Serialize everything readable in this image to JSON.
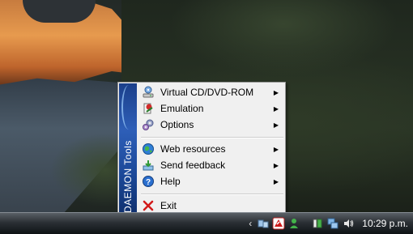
{
  "menu": {
    "banner_text": "DAEMON Tools",
    "items": [
      {
        "label": "Virtual CD/DVD-ROM",
        "icon": "virtual-drive-icon",
        "submenu": true
      },
      {
        "label": "Emulation",
        "icon": "emulation-icon",
        "submenu": true
      },
      {
        "label": "Options",
        "icon": "options-gear-icon",
        "submenu": true
      },
      {
        "label": "Web resources",
        "icon": "globe-icon",
        "submenu": true
      },
      {
        "label": "Send feedback",
        "icon": "send-feedback-icon",
        "submenu": true
      },
      {
        "label": "Help",
        "icon": "help-icon",
        "submenu": true
      },
      {
        "label": "Exit",
        "icon": "exit-x-icon",
        "submenu": false
      }
    ]
  },
  "tray": {
    "clock": "10:29 p.m.",
    "icons": [
      "show-hidden-chevron",
      "network-icon",
      "daemon-tools-tray-icon",
      "messenger-user-icon",
      "battery-power-icon",
      "network-connection-icon",
      "volume-icon"
    ]
  },
  "colors": {
    "menu_background": "#f0f0f0",
    "banner_blue": "#1f4c9d",
    "exit_red": "#d21a1a"
  }
}
